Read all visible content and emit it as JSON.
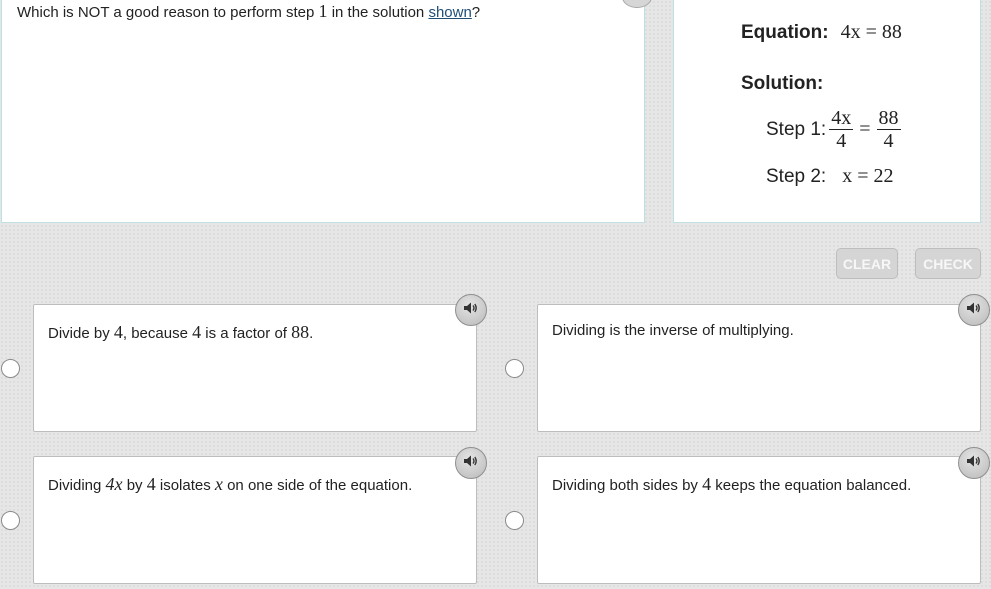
{
  "question": {
    "text_before": "Which is NOT a good reason to perform step ",
    "step_number": "1",
    "text_middle": " in the solution ",
    "link_text": "shown",
    "text_after": "?"
  },
  "equation_panel": {
    "equation_label": "Equation:",
    "equation": "4x = 88",
    "solution_label": "Solution:",
    "step1_label": "Step 1:",
    "step1_left_num": "4x",
    "step1_left_den": "4",
    "step1_equals": "=",
    "step1_right_num": "88",
    "step1_right_den": "4",
    "step2_label": "Step 2:",
    "step2_equation": "x = 22"
  },
  "buttons": {
    "clear": "CLEAR",
    "check": "CHECK"
  },
  "choices": {
    "a": {
      "p1": "Divide by ",
      "m1": "4",
      "p2": ", because ",
      "m2": "4",
      "p3": " is a factor of ",
      "m3": "88",
      "p4": "."
    },
    "b": {
      "text": "Dividing is the inverse of multiplying."
    },
    "c": {
      "p1": "Dividing ",
      "m1": "4x",
      "p2": " by ",
      "m2": "4",
      "p3": " isolates ",
      "m3": "x",
      "p4": " on one side of the equation."
    },
    "d": {
      "p1": "Dividing both sides by ",
      "m1": "4",
      "p2": " keeps the equation balanced."
    }
  },
  "icons": {
    "audio": "speaker-icon",
    "radio": "radio-circle"
  },
  "colors": {
    "panel_border": "#bfe0e3",
    "link": "#1f4e79",
    "button_bg": "#d5d5d5",
    "button_text": "#f7f7f7"
  }
}
